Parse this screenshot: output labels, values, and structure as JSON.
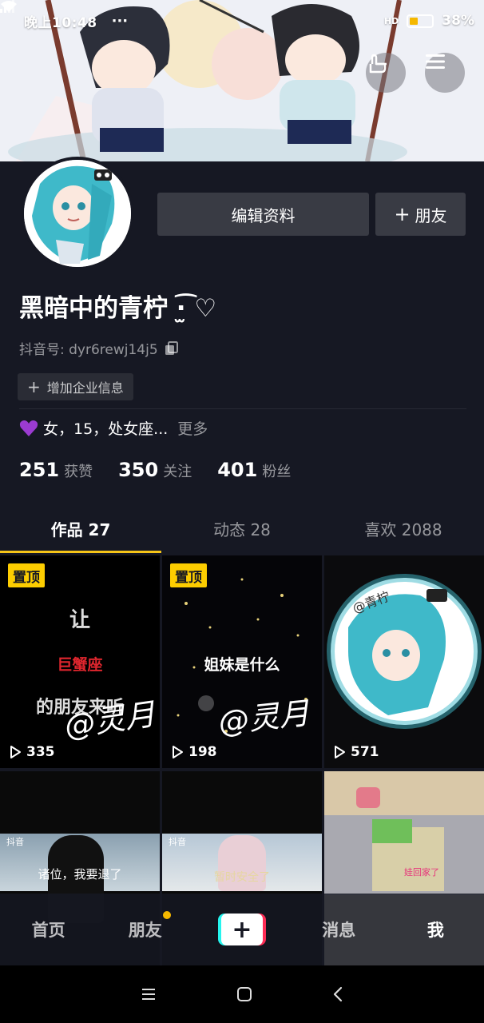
{
  "status_bar": {
    "time": "晚上10:48",
    "dots": "···",
    "network": "HD",
    "battery": "38%"
  },
  "profile": {
    "nickname": "黑暗中的青柠 ·̫͡ ♡",
    "douyin_id": "抖音号: dyr6rewj14j5",
    "edit_label": "编辑资料",
    "friend_label": "朋友",
    "enterprise_label": "增加企业信息",
    "bio": "女，15，处女座...",
    "more_label": "更多"
  },
  "stats": [
    {
      "num": "251",
      "label": "获赞"
    },
    {
      "num": "350",
      "label": "关注"
    },
    {
      "num": "401",
      "label": "粉丝"
    }
  ],
  "tabs": [
    {
      "label": "作品 27"
    },
    {
      "label": "动态 28"
    },
    {
      "label": "喜欢 2088"
    }
  ],
  "videos": [
    {
      "pinned": "置顶",
      "plays": "335",
      "line1": "让",
      "line2": "巨蟹座",
      "line3": "的朋友来听",
      "sig": "@灵月"
    },
    {
      "pinned": "置顶",
      "plays": "198",
      "line1": "姐妹是什么",
      "sig": "@灵月"
    },
    {
      "plays": "571",
      "sig": "@青柠"
    },
    {
      "caption": "诸位，我要退了",
      "logo": "抖音"
    },
    {
      "caption": "暂时安全了",
      "logo": "抖音"
    },
    {
      "caption": "娃回家了"
    }
  ],
  "bottom_nav": [
    {
      "label": "首页"
    },
    {
      "label": "朋友"
    },
    {
      "label": "+"
    },
    {
      "label": "消息"
    },
    {
      "label": "我"
    }
  ],
  "colors": {
    "bg": "#161823",
    "accent": "#f5c518",
    "pin": "#fdcd00"
  }
}
